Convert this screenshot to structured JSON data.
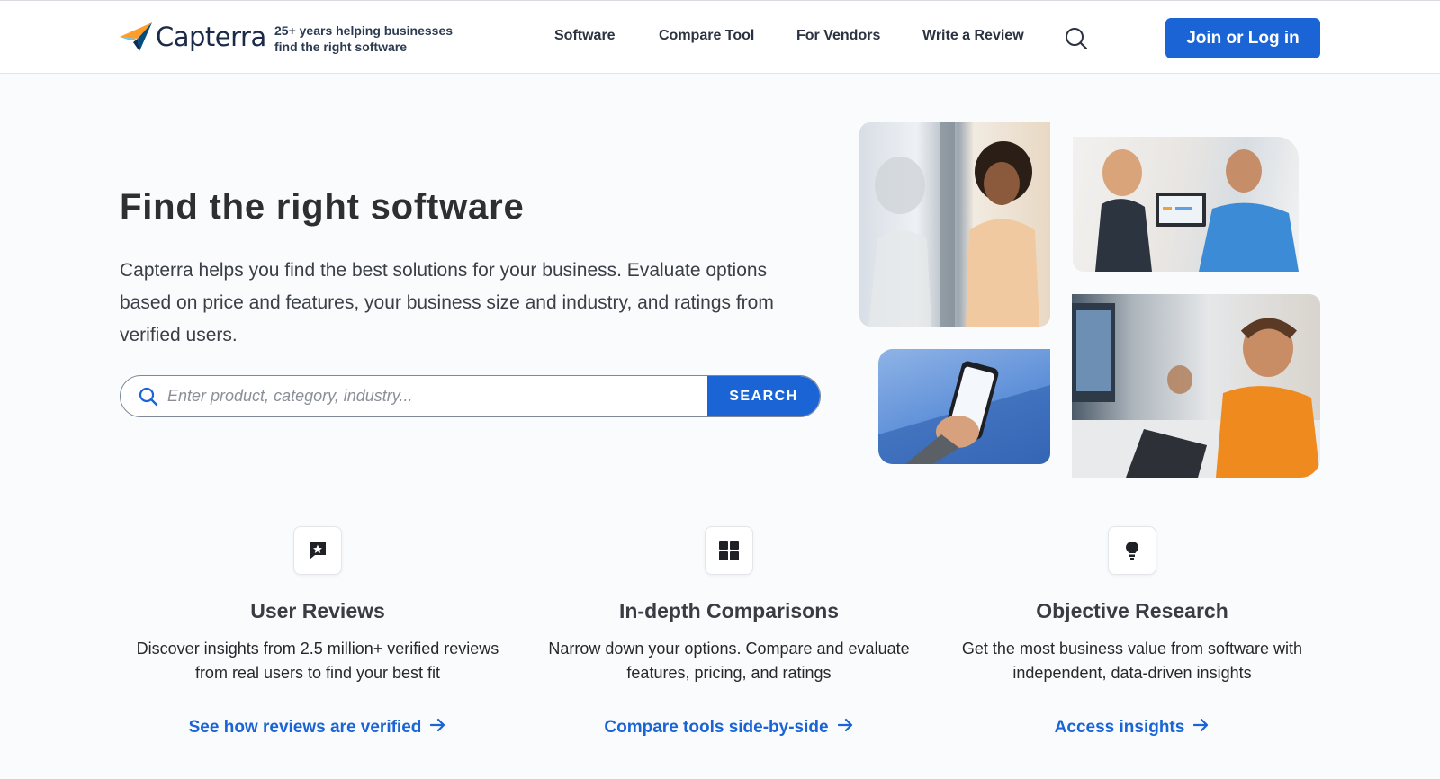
{
  "header": {
    "logo_text": "Capterra",
    "tagline_line1": "25+ years helping businesses",
    "tagline_line2": "find the right software",
    "nav": [
      "Software",
      "Compare Tool",
      "For Vendors",
      "Write a Review"
    ],
    "join_label": "Join or Log in"
  },
  "hero": {
    "title": "Find the right software",
    "description": "Capterra helps you find the best solutions for your business. Evaluate options based on price and features, your business size and industry, and ratings from verified users.",
    "search_placeholder": "Enter product, category, industry...",
    "search_button": "SEARCH"
  },
  "features": [
    {
      "icon": "star-review-icon",
      "title": "User Reviews",
      "description": "Discover insights from 2.5 million+ verified reviews from real users to find your best fit",
      "link": "See how reviews are verified"
    },
    {
      "icon": "grid-icon",
      "title": "In-depth Comparisons",
      "description": "Narrow down your options. Compare and evaluate features, pricing, and ratings",
      "link": "Compare tools side-by-side"
    },
    {
      "icon": "lightbulb-icon",
      "title": "Objective Research",
      "description": "Get the most business value from software with independent, data-driven insights",
      "link": "Access insights"
    }
  ],
  "colors": {
    "brand_blue": "#1a64d6",
    "logo_orange": "#ff9d28",
    "logo_blue": "#68c5ed",
    "logo_dark": "#044d80"
  }
}
